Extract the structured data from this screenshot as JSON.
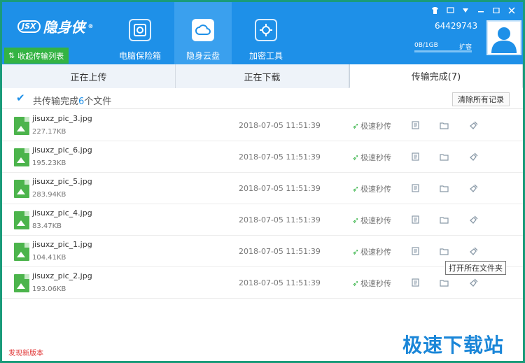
{
  "app": {
    "brand_mark": "JSX",
    "brand_name": "隐身侠",
    "registered": "®"
  },
  "header": {
    "collapse_label": "收起传输列表",
    "nav": [
      {
        "label": "电脑保险箱",
        "icon": "safe-icon"
      },
      {
        "label": "隐身云盘",
        "icon": "cloud-icon"
      },
      {
        "label": "加密工具",
        "icon": "gear-tool-icon"
      }
    ],
    "window_controls": [
      "skin-icon",
      "feedback-icon",
      "menu-icon",
      "minimize-icon",
      "maximize-icon",
      "close-icon"
    ],
    "user_id": "64429743",
    "quota_used": "0B/1GB",
    "quota_expand": "扩容",
    "quota_fraction": 0
  },
  "tabs": [
    {
      "label": "正在上传"
    },
    {
      "label": "正在下载"
    },
    {
      "label": "传输完成(7)"
    }
  ],
  "summary": {
    "prefix": "共传输完成",
    "count": "6",
    "suffix": "个文件",
    "clear_label": "清除所有记录"
  },
  "files": [
    {
      "name": "jisuxz_pic_3.jpg",
      "size": "227.17KB",
      "date": "2018-07-05 11:51:39",
      "status": "极速秒传"
    },
    {
      "name": "jisuxz_pic_6.jpg",
      "size": "195.23KB",
      "date": "2018-07-05 11:51:39",
      "status": "极速秒传"
    },
    {
      "name": "jisuxz_pic_5.jpg",
      "size": "283.94KB",
      "date": "2018-07-05 11:51:39",
      "status": "极速秒传"
    },
    {
      "name": "jisuxz_pic_4.jpg",
      "size": "83.47KB",
      "date": "2018-07-05 11:51:39",
      "status": "极速秒传"
    },
    {
      "name": "jisuxz_pic_1.jpg",
      "size": "104.41KB",
      "date": "2018-07-05 11:51:39",
      "status": "极速秒传"
    },
    {
      "name": "jisuxz_pic_2.jpg",
      "size": "193.06KB",
      "date": "2018-07-05 11:51:39",
      "status": "极速秒传"
    }
  ],
  "tooltip": "打开所在文件夹",
  "footer": {
    "new_version": "发现新版本",
    "watermark": "极速下载站"
  },
  "colors": {
    "header": "#1e90e8",
    "accent_green": "#34b343",
    "link_red": "#e03030"
  }
}
